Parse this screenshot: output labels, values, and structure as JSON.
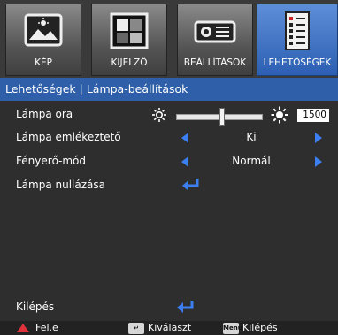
{
  "tabs": [
    {
      "label": "KÉP",
      "icon": "picture-icon",
      "active": false
    },
    {
      "label": "KIJELZŐ",
      "icon": "display-icon",
      "active": false
    },
    {
      "label": "BEÁLLÍTÁSOK",
      "icon": "projector-icon",
      "active": false
    },
    {
      "label": "LEHETŐSÉGEK",
      "icon": "options-list-icon",
      "active": true
    }
  ],
  "breadcrumb": "Lehetőségek | Lámpa-beállítások",
  "menu": {
    "lamp_hours": {
      "label": "Lámpa ora",
      "value": "1500",
      "slider_fraction": 0.53
    },
    "lamp_reminder": {
      "label": "Lámpa emlékeztető",
      "value": "Ki"
    },
    "brightness_mode": {
      "label": "Fényerő-mód",
      "value": "Normál"
    },
    "lamp_reset": {
      "label": "Lámpa nullázása"
    },
    "exit": {
      "label": "Kilépés"
    }
  },
  "footer": {
    "exit_label": "Fel.e",
    "select_label": "Kiválaszt",
    "menu_key": "Menu",
    "quit_label": "Kilépés"
  },
  "colors": {
    "accent": "#2f5fa8",
    "arrow": "#3c7ff0",
    "active_tab": "#3d72c4"
  }
}
